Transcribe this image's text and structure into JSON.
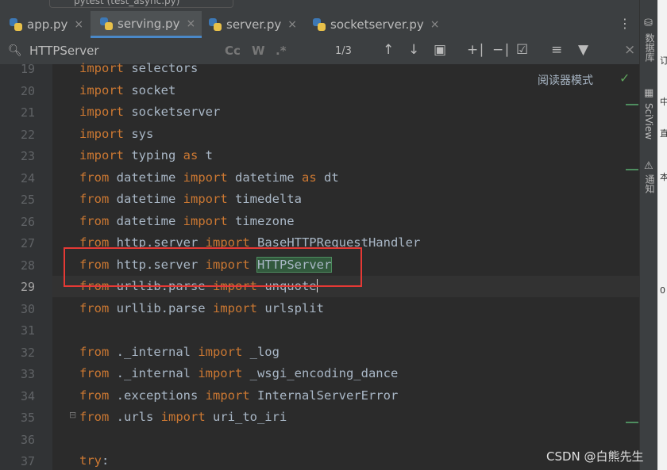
{
  "window": {
    "title": "pytest (test_async.py)"
  },
  "tabs": [
    {
      "label": "app.py",
      "close": "×"
    },
    {
      "label": "serving.py",
      "close": "×"
    },
    {
      "label": "server.py",
      "close": "×"
    },
    {
      "label": "socketserver.py",
      "close": "×"
    }
  ],
  "tabs_more": "⋮",
  "search": {
    "query": "HTTPServer",
    "match_case": "Cc",
    "words": "W",
    "regex": ".*",
    "count": "1/3"
  },
  "editor": {
    "reader_mode": "阅读器模式",
    "current_line": "29",
    "lines": [
      {
        "n": "19",
        "tokens": [
          {
            "t": "import",
            "k": "kw"
          },
          {
            "t": " selectors",
            "k": ""
          }
        ]
      },
      {
        "n": "20",
        "tokens": [
          {
            "t": "import",
            "k": "kw"
          },
          {
            "t": " socket",
            "k": ""
          }
        ]
      },
      {
        "n": "21",
        "tokens": [
          {
            "t": "import",
            "k": "kw"
          },
          {
            "t": " socketserver",
            "k": ""
          }
        ]
      },
      {
        "n": "22",
        "tokens": [
          {
            "t": "import",
            "k": "kw"
          },
          {
            "t": " sys",
            "k": ""
          }
        ]
      },
      {
        "n": "23",
        "tokens": [
          {
            "t": "import",
            "k": "kw"
          },
          {
            "t": " typing ",
            "k": ""
          },
          {
            "t": "as",
            "k": "kw"
          },
          {
            "t": " t",
            "k": ""
          }
        ]
      },
      {
        "n": "24",
        "tokens": [
          {
            "t": "from",
            "k": "kw"
          },
          {
            "t": " datetime ",
            "k": ""
          },
          {
            "t": "import",
            "k": "kw"
          },
          {
            "t": " datetime ",
            "k": ""
          },
          {
            "t": "as",
            "k": "kw"
          },
          {
            "t": " dt",
            "k": ""
          }
        ]
      },
      {
        "n": "25",
        "tokens": [
          {
            "t": "from",
            "k": "kw"
          },
          {
            "t": " datetime ",
            "k": ""
          },
          {
            "t": "import",
            "k": "kw"
          },
          {
            "t": " timedelta",
            "k": ""
          }
        ]
      },
      {
        "n": "26",
        "tokens": [
          {
            "t": "from",
            "k": "kw"
          },
          {
            "t": " datetime ",
            "k": ""
          },
          {
            "t": "import",
            "k": "kw"
          },
          {
            "t": " timezone",
            "k": ""
          }
        ]
      },
      {
        "n": "27",
        "tokens": [
          {
            "t": "from",
            "k": "kw"
          },
          {
            "t": " http.server ",
            "k": ""
          },
          {
            "t": "import",
            "k": "kw"
          },
          {
            "t": " BaseHTTPRequestHandler",
            "k": ""
          }
        ]
      },
      {
        "n": "28",
        "tokens": [
          {
            "t": "from",
            "k": "kw"
          },
          {
            "t": " http.server ",
            "k": ""
          },
          {
            "t": "import",
            "k": "kw"
          },
          {
            "t": " ",
            "k": ""
          },
          {
            "t": "HTTPServer",
            "k": "hl"
          }
        ]
      },
      {
        "n": "29",
        "tokens": [
          {
            "t": "from",
            "k": "kw"
          },
          {
            "t": " urllib.parse ",
            "k": ""
          },
          {
            "t": "import",
            "k": "kw"
          },
          {
            "t": " unquote",
            "k": ""
          },
          {
            "t": "",
            "k": "caret"
          }
        ]
      },
      {
        "n": "30",
        "tokens": [
          {
            "t": "from",
            "k": "kw"
          },
          {
            "t": " urllib.parse ",
            "k": ""
          },
          {
            "t": "import",
            "k": "kw"
          },
          {
            "t": " urlsplit",
            "k": ""
          }
        ]
      },
      {
        "n": "31",
        "tokens": []
      },
      {
        "n": "32",
        "tokens": [
          {
            "t": "from",
            "k": "kw"
          },
          {
            "t": " ._internal ",
            "k": ""
          },
          {
            "t": "import",
            "k": "kw"
          },
          {
            "t": " _log",
            "k": ""
          }
        ]
      },
      {
        "n": "33",
        "tokens": [
          {
            "t": "from",
            "k": "kw"
          },
          {
            "t": " ._internal ",
            "k": ""
          },
          {
            "t": "import",
            "k": "kw"
          },
          {
            "t": " _wsgi_encoding_dance",
            "k": ""
          }
        ]
      },
      {
        "n": "34",
        "tokens": [
          {
            "t": "from",
            "k": "kw"
          },
          {
            "t": " .exceptions ",
            "k": ""
          },
          {
            "t": "import",
            "k": "kw"
          },
          {
            "t": " InternalServerError",
            "k": ""
          }
        ]
      },
      {
        "n": "35",
        "tokens": [
          {
            "t": "from",
            "k": "kw"
          },
          {
            "t": " .urls ",
            "k": ""
          },
          {
            "t": "import",
            "k": "kw"
          },
          {
            "t": " uri_to_iri",
            "k": ""
          }
        ]
      },
      {
        "n": "36",
        "tokens": []
      },
      {
        "n": "37",
        "tokens": [
          {
            "t": "try",
            "k": "kw"
          },
          {
            "t": ":",
            "k": ""
          }
        ]
      }
    ]
  },
  "right_sidebar": {
    "database": "数据库",
    "sciview": "SciView",
    "notifications": "通知"
  },
  "watermark": "CSDN @白熊先生"
}
